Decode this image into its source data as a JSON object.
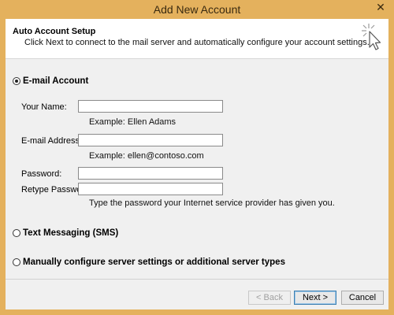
{
  "window": {
    "title": "Add New Account",
    "close_glyph": "✕"
  },
  "header": {
    "title": "Auto Account Setup",
    "subtitle": "Click Next to connect to the mail server and automatically configure your account settings.",
    "icon": "wizard-cursor-icon"
  },
  "options": {
    "email_account": {
      "label": "E-mail Account",
      "selected": true
    },
    "text_messaging": {
      "label": "Text Messaging (SMS)",
      "selected": false
    },
    "manual_config": {
      "label": "Manually configure server settings or additional server types",
      "selected": false
    }
  },
  "form": {
    "name": {
      "label": "Your Name:",
      "value": "",
      "hint": "Example: Ellen Adams"
    },
    "email": {
      "label": "E-mail Address:",
      "value": "",
      "hint": "Example: ellen@contoso.com"
    },
    "password": {
      "label": "Password:",
      "value": ""
    },
    "retype_password": {
      "label": "Retype Password:",
      "value": ""
    },
    "password_hint": "Type the password your Internet service provider has given you."
  },
  "buttons": {
    "back": "< Back",
    "next": "Next >",
    "cancel": "Cancel"
  },
  "colors": {
    "title_bar": "#e4b15d",
    "dialog_background": "#f0f0f0",
    "header_background": "#ffffff"
  }
}
